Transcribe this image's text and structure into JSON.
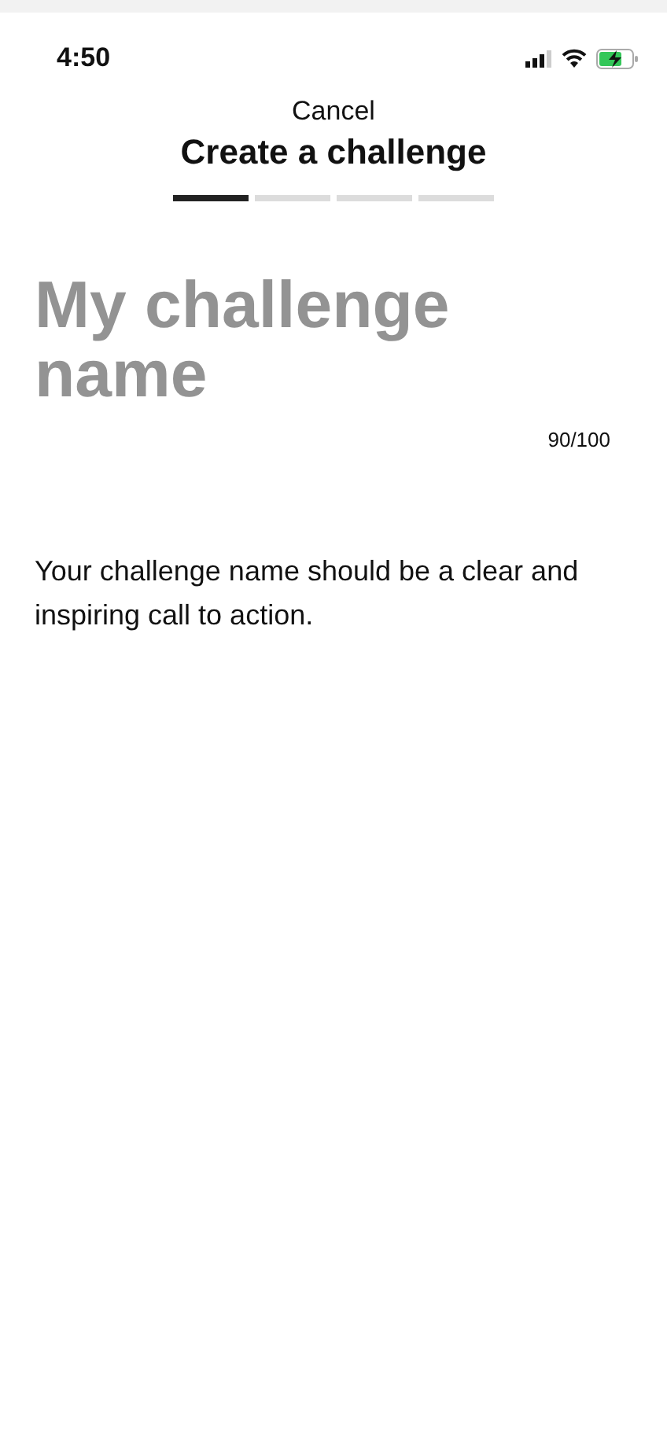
{
  "status_bar": {
    "time": "4:50"
  },
  "header": {
    "cancel": "Cancel",
    "title": "Create a challenge"
  },
  "steps": [
    {
      "selected": true
    },
    {
      "selected": false
    },
    {
      "selected": false
    },
    {
      "selected": false
    }
  ],
  "name_field": {
    "placeholder": "My challenge name",
    "counter": "90/100"
  },
  "help_text": "Your challenge name should be a clear and inspiring call to action."
}
